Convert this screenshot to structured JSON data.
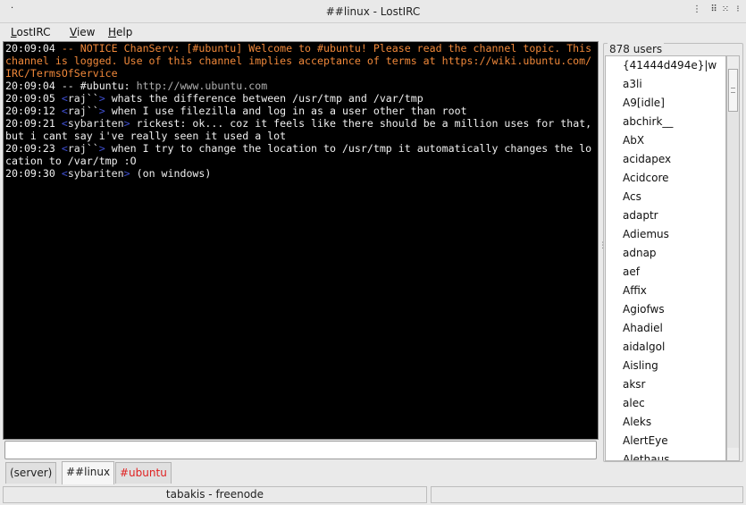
{
  "window": {
    "title": "##linux - LostIRC",
    "sys_icon": "·",
    "buttons": [
      "⋮",
      "⠿",
      "⁙",
      "⁝"
    ]
  },
  "menu": [
    {
      "accel": "L",
      "rest": "ostIRC"
    },
    {
      "accel": "V",
      "rest": "iew"
    },
    {
      "accel": "H",
      "rest": "elp"
    }
  ],
  "chat": {
    "lines": [
      {
        "time": "20:09:04",
        "segments": [
          {
            "t": " -- NOTICE ChanServ: [#ubuntu] Welcome to #ubuntu! Please read the channel topic. This channel is logged. Use of this channel implies acceptance of terms at https://wiki.ubuntu.com/IRC/TermsOfService",
            "c": "notice"
          }
        ]
      },
      {
        "time": "20:09:04",
        "segments": [
          {
            "t": " -- #ubuntu: ",
            "c": ""
          },
          {
            "t": "http://www.ubuntu.com",
            "c": "link"
          }
        ]
      },
      {
        "time": "20:09:05",
        "segments": [
          {
            "t": " <",
            "c": "nickmark"
          },
          {
            "t": "raj``",
            "c": "nick"
          },
          {
            "t": "> ",
            "c": "nickmark"
          },
          {
            "t": "whats the difference between /usr/tmp and /var/tmp",
            "c": ""
          }
        ]
      },
      {
        "time": "20:09:12",
        "segments": [
          {
            "t": " <",
            "c": "nickmark"
          },
          {
            "t": "raj``",
            "c": "nick"
          },
          {
            "t": "> ",
            "c": "nickmark"
          },
          {
            "t": "when I use filezilla and log in as a user other than root",
            "c": ""
          }
        ]
      },
      {
        "time": "20:09:21",
        "segments": [
          {
            "t": " <",
            "c": "nickmark"
          },
          {
            "t": "sybariten",
            "c": "nick"
          },
          {
            "t": "> ",
            "c": "nickmark"
          },
          {
            "t": "rickest: ok... coz it feels like there should be a million uses for that, but i cant say i've really seen it used a lot",
            "c": ""
          }
        ]
      },
      {
        "time": "20:09:23",
        "segments": [
          {
            "t": " <",
            "c": "nickmark"
          },
          {
            "t": "raj``",
            "c": "nick"
          },
          {
            "t": "> ",
            "c": "nickmark"
          },
          {
            "t": "when I try to change the location to /usr/tmp it automatically changes the location to /var/tmp :O",
            "c": ""
          }
        ]
      },
      {
        "time": "20:09:30",
        "segments": [
          {
            "t": " <",
            "c": "nickmark"
          },
          {
            "t": "sybariten",
            "c": "nick"
          },
          {
            "t": "> ",
            "c": "nickmark"
          },
          {
            "t": "(on windows)",
            "c": ""
          }
        ]
      }
    ]
  },
  "users": {
    "header": "878 users",
    "list": [
      "{41444d494e}|w",
      "a3li",
      "A9[idle]",
      "abchirk__",
      "AbX",
      "acidapex",
      "Acidcore",
      "Acs",
      "adaptr",
      "Adiemus",
      "adnap",
      "aef",
      "Affix",
      "Agiofws",
      "Ahadiel",
      "aidalgol",
      "Aisling",
      "aksr",
      "alec",
      "Aleks",
      "AlertEye",
      "Alethaus"
    ]
  },
  "input": {
    "value": ""
  },
  "tabs": [
    {
      "label": "(server)",
      "state": "normal"
    },
    {
      "label": "##linux",
      "state": "active"
    },
    {
      "label": "#ubuntu",
      "state": "alert"
    }
  ],
  "status": {
    "left": "tabakis - freenode",
    "right": ""
  }
}
